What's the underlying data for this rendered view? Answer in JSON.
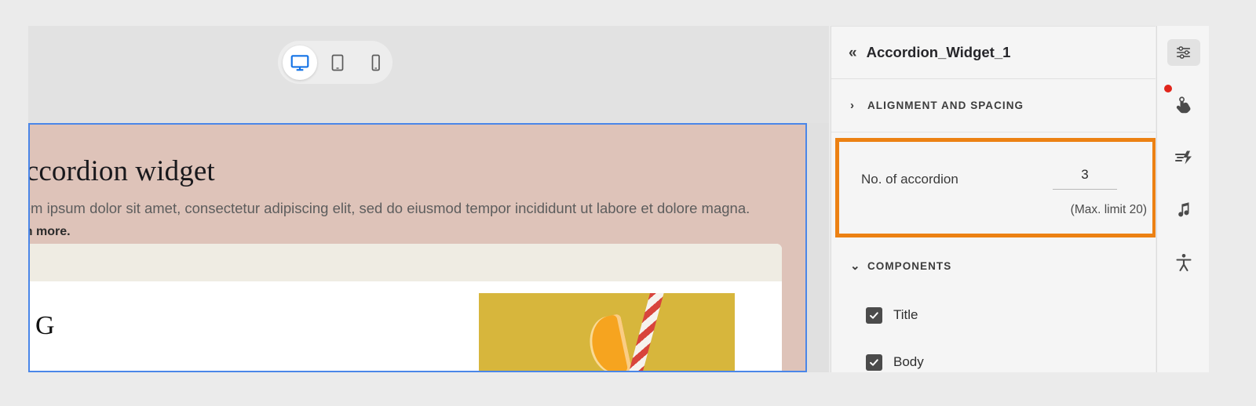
{
  "canvas": {
    "device_switch": {
      "options": [
        {
          "name": "desktop",
          "icon": "desktop-icon",
          "active": true
        },
        {
          "name": "tablet",
          "icon": "tablet-icon",
          "active": false
        },
        {
          "name": "mobile",
          "icon": "mobile-icon",
          "active": false
        }
      ]
    },
    "page": {
      "hero_title": "Accordion widget",
      "hero_subtitle": "Lorem ipsum dolor sit amet, consectetur adipiscing elit, sed do eiusmod tempor incididunt ut labore et dolore magna.",
      "hero_link": "Learn more.",
      "card_letter": "G",
      "photo_alt": "orange-slice-with-straw"
    },
    "selection_color": "#4a86e8",
    "hero_bg_color": "#dec3b9"
  },
  "settings": {
    "header": {
      "collapse_icon": "chevron-double-left-icon",
      "title": "Accordion_Widget_1"
    },
    "sections": [
      {
        "label": "ALIGNMENT AND SPACING",
        "chevron": "chevron-right-icon",
        "expanded": false
      }
    ],
    "accordion_field": {
      "label": "No. of accordion",
      "value": "3",
      "hint": "(Max. limit 20)",
      "highlight_color": "#ec8113"
    },
    "components": {
      "label": "COMPONENTS",
      "chevron": "chevron-down-icon",
      "expanded": true,
      "items": [
        {
          "label": "Title",
          "checked": true
        },
        {
          "label": "Body",
          "checked": true
        }
      ]
    }
  },
  "icon_rail": {
    "items": [
      {
        "name": "settings-sliders-icon",
        "selected": true,
        "badge": false
      },
      {
        "name": "interaction-tap-icon",
        "selected": false,
        "badge": true
      },
      {
        "name": "motion-speed-icon",
        "selected": false,
        "badge": false
      },
      {
        "name": "audio-music-icon",
        "selected": false,
        "badge": false
      },
      {
        "name": "accessibility-icon",
        "selected": false,
        "badge": false
      }
    ],
    "badge_color": "#e1251b"
  }
}
